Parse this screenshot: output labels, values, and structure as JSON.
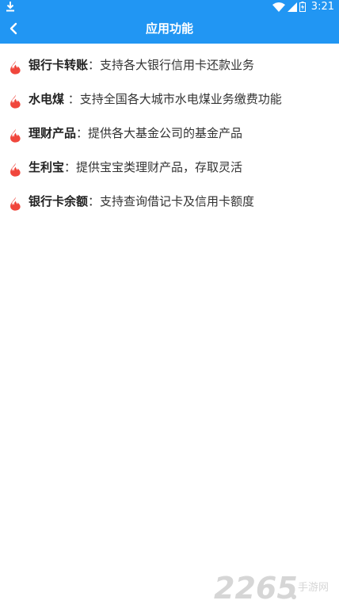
{
  "status_bar": {
    "time": "3:21",
    "icons": [
      "download-icon",
      "wifi-icon",
      "signal-icon",
      "battery-icon"
    ]
  },
  "app_bar": {
    "title": "应用功能",
    "back_icon": "chevron-left-icon"
  },
  "features": [
    {
      "name": "银行卡转账",
      "desc": "：支持各大银行信用卡还款业务",
      "icon": "flame-icon"
    },
    {
      "name": "水电煤",
      "desc": " ：支持全国各大城市水电煤业务缴费功能",
      "icon": "flame-icon"
    },
    {
      "name": "理财产品",
      "desc": "：提供各大基金公司的基金产品",
      "icon": "flame-icon"
    },
    {
      "name": "生利宝",
      "desc": "：提供宝宝类理财产品，存取灵活",
      "icon": "flame-icon"
    },
    {
      "name": "银行卡余额",
      "desc": "：支持查询借记卡及信用卡额度",
      "icon": "flame-icon"
    }
  ],
  "watermark": {
    "number": "2265",
    "dot": ".",
    "sub": "手游网"
  },
  "colors": {
    "primary": "#2196f3",
    "flame": "#f0463c",
    "text": "#333333"
  }
}
